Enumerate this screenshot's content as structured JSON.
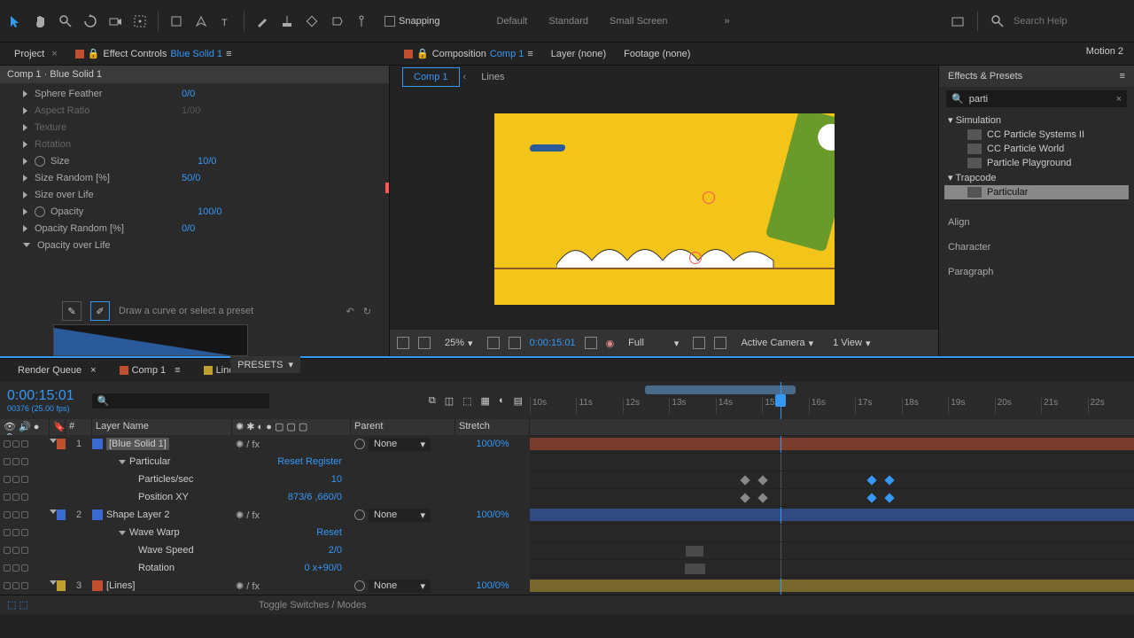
{
  "toolbar": {
    "snapping": "Snapping",
    "workspaces": [
      "Default",
      "Standard",
      "Small Screen"
    ],
    "search_placeholder": "Search Help"
  },
  "panels": {
    "project": "Project",
    "effect_controls": "Effect Controls",
    "effect_controls_target": "Blue Solid 1",
    "composition": "Composition",
    "composition_target": "Comp 1",
    "layer": "Layer  (none)",
    "footage": "Footage  (none)",
    "motion": "Motion 2"
  },
  "effect_controls": {
    "breadcrumb": "Comp 1 · Blue Solid 1",
    "rows": [
      {
        "label": "Sphere Feather",
        "value": "0/0"
      },
      {
        "label": "Aspect Ratio",
        "value": "1/00",
        "dim": true
      },
      {
        "label": "Texture",
        "value": "",
        "dim": true
      },
      {
        "label": "Rotation",
        "value": "",
        "dim": true
      },
      {
        "label": "Size",
        "value": "10/0",
        "stopwatch": true
      },
      {
        "label": "Size Random [%]",
        "value": "50/0"
      },
      {
        "label": "Size over Life",
        "value": ""
      },
      {
        "label": "Opacity",
        "value": "100/0",
        "stopwatch": true
      },
      {
        "label": "Opacity Random [%]",
        "value": "0/0"
      },
      {
        "label": "Opacity over Life",
        "value": "",
        "down": true
      }
    ],
    "curve_hint": "Draw a curve or select a preset",
    "presets": "PRESETS"
  },
  "comp_viewer": {
    "tabs": [
      "Comp 1",
      "Lines"
    ],
    "zoom": "25%",
    "time": "0:00:15:01",
    "resolution": "Full",
    "camera": "Active Camera",
    "view": "1 View"
  },
  "right": {
    "effects_presets": "Effects & Presets",
    "search": "parti",
    "categories": {
      "simulation": "Simulation",
      "sim_items": [
        "CC Particle Systems II",
        "CC Particle World",
        "Particle Playground"
      ],
      "trapcode": "Trapcode",
      "trap_items": [
        "Particular"
      ]
    },
    "align": "Align",
    "character": "Character",
    "paragraph": "Paragraph"
  },
  "timeline": {
    "tabs": {
      "render_queue": "Render Queue",
      "comp": "Comp 1",
      "lines": "Lines"
    },
    "timecode": "0:00:15:01",
    "timecode_sub": "00376 (25.00 fps)",
    "columns": {
      "num": "#",
      "layer_name": "Layer Name",
      "parent": "Parent",
      "stretch": "Stretch"
    },
    "ruler": [
      "10s",
      "11s",
      "12s",
      "13s",
      "14s",
      "15s",
      "16s",
      "17s",
      "18s",
      "19s",
      "20s",
      "21s",
      "22s"
    ],
    "parent_none": "None",
    "stretch_val": "100/0%",
    "layers": [
      {
        "num": "1",
        "color": "#c05030",
        "icon_color": "#3a6ad0",
        "name": "[Blue Solid 1]",
        "selected": true,
        "sub": [
          {
            "label": "Particular",
            "value": "Reset    Register",
            "tri": "down"
          },
          {
            "label": "Particles/sec",
            "value": "10",
            "stopwatch": true,
            "kf": true
          },
          {
            "label": "Position XY",
            "value": "873/6 ,660/0",
            "stopwatch": true,
            "kf": true
          }
        ]
      },
      {
        "num": "2",
        "color": "#3a6ad0",
        "icon_color": "#3a6ad0",
        "name": "Shape Layer 2",
        "sub": [
          {
            "label": "Wave Warp",
            "value": "Reset",
            "tri": "down"
          },
          {
            "label": "Wave Speed",
            "value": "2/0",
            "stopwatch": true
          },
          {
            "label": "Rotation",
            "value": "0 x+90/0",
            "stopwatch": true
          }
        ]
      },
      {
        "num": "3",
        "color": "#c0a030",
        "icon_color": "#c05030",
        "name": "[Lines]"
      }
    ],
    "toggle": "Toggle Switches / Modes"
  }
}
